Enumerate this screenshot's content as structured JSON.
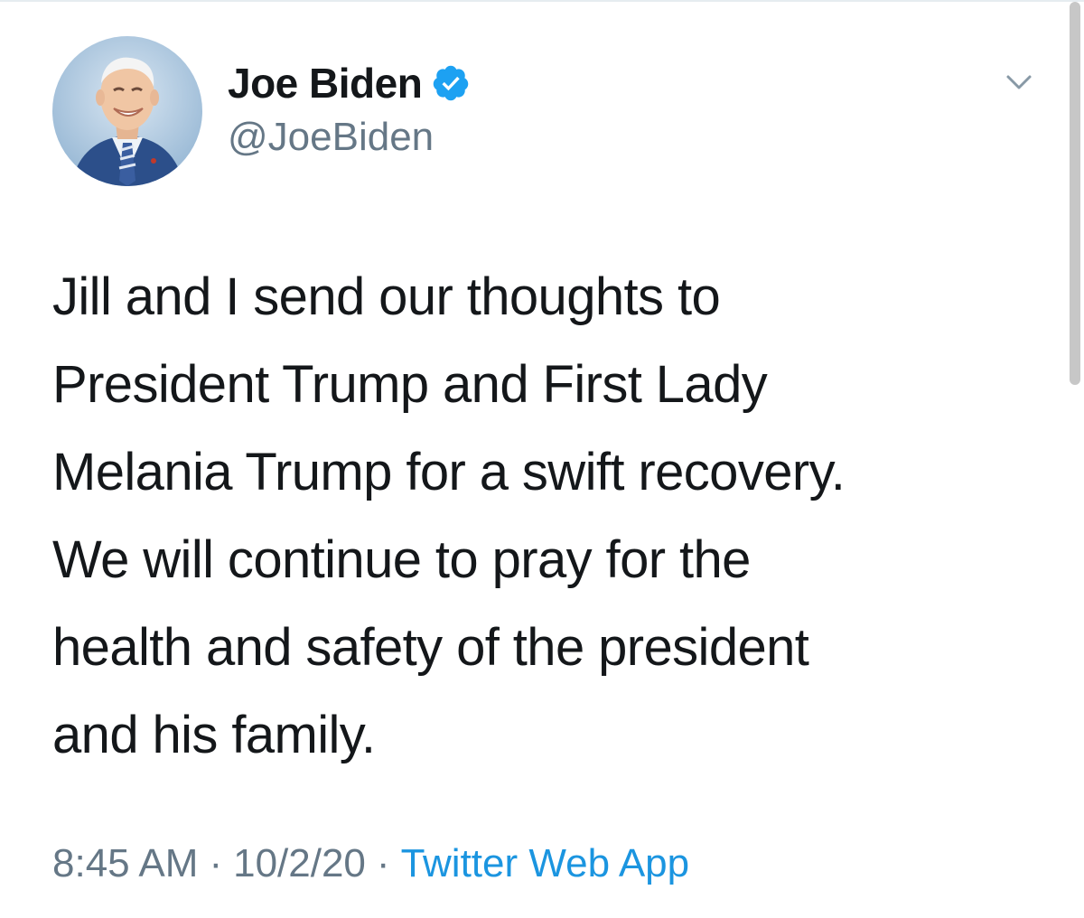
{
  "author": {
    "display_name": "Joe Biden",
    "handle": "@JoeBiden",
    "verified": true,
    "avatar": "profile-photo"
  },
  "tweet": {
    "lines": [
      "Jill and I send our thoughts to",
      "President Trump and First Lady",
      "Melania Trump for a swift recovery.",
      "We will continue to pray for the",
      "health and safety of the president",
      "and his family."
    ],
    "time": "8:45 AM",
    "separator": "·",
    "date": "10/2/20",
    "source": "Twitter Web App"
  },
  "icons": {
    "verified": "verified-badge-icon",
    "menu": "chevron-down-icon"
  },
  "colors": {
    "text": "#14171a",
    "secondary_text": "#657786",
    "link": "#1b95e0",
    "verified": "#1da1f2",
    "divider": "#e6ecf0"
  }
}
